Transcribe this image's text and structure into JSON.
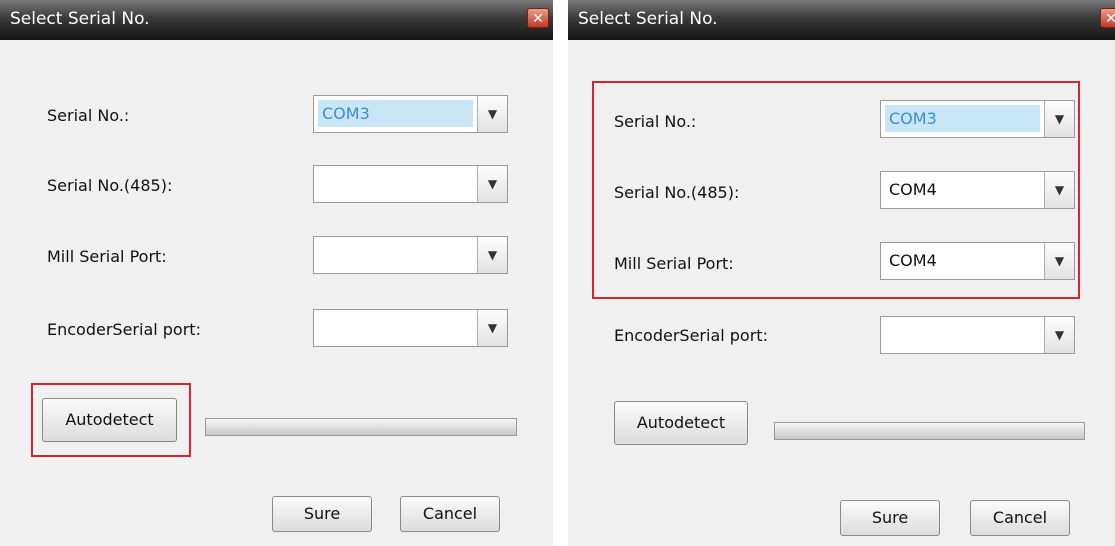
{
  "dialog_left": {
    "title": "Select Serial No.",
    "close_label": "✕",
    "fields": [
      {
        "label": "Serial No.:",
        "value": "COM3",
        "selected": true
      },
      {
        "label": "Serial No.(485):",
        "value": "",
        "selected": false
      },
      {
        "label": "Mill Serial Port:",
        "value": "",
        "selected": false
      },
      {
        "label": "EncoderSerial port:",
        "value": "",
        "selected": false
      }
    ],
    "autodetect_label": "Autodetect",
    "sure_label": "Sure",
    "cancel_label": "Cancel"
  },
  "dialog_right": {
    "title": "Select Serial No.",
    "close_label": "✕",
    "fields": [
      {
        "label": "Serial No.:",
        "value": "COM3",
        "selected": true
      },
      {
        "label": "Serial No.(485):",
        "value": "COM4",
        "selected": false
      },
      {
        "label": "Mill Serial Port:",
        "value": "COM4",
        "selected": false
      },
      {
        "label": "EncoderSerial port:",
        "value": "",
        "selected": false
      }
    ],
    "autodetect_label": "Autodetect",
    "sure_label": "Sure",
    "cancel_label": "Cancel"
  },
  "icons": {
    "dropdown": "▼"
  },
  "colors": {
    "highlight": "#d9232d",
    "selection": "#c9e6f7",
    "title_bar": "#2a2a2a"
  }
}
